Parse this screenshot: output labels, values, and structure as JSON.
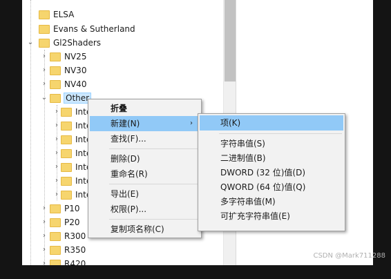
{
  "tree": {
    "items": [
      {
        "label": "ELSA"
      },
      {
        "label": "Evans & Sutherland"
      },
      {
        "label": "Gl2Shaders"
      },
      {
        "label": "NV25"
      },
      {
        "label": "NV30"
      },
      {
        "label": "NV40"
      },
      {
        "label": "Other"
      },
      {
        "label": "Inte"
      },
      {
        "label": "Inte"
      },
      {
        "label": "Inte"
      },
      {
        "label": "Inte"
      },
      {
        "label": "Inte"
      },
      {
        "label": "Inte"
      },
      {
        "label": "Inte"
      },
      {
        "label": "P10"
      },
      {
        "label": "P20"
      },
      {
        "label": "R300"
      },
      {
        "label": "R350"
      },
      {
        "label": "R420"
      }
    ],
    "expand_glyph": "⌄",
    "collapse_glyph": "›"
  },
  "context_menu": {
    "items": [
      "折叠",
      "新建(N)",
      "查找(F)...",
      "删除(D)",
      "重命名(R)",
      "导出(E)",
      "权限(P)...",
      "复制项名称(C)"
    ],
    "submenu_arrow": "›"
  },
  "submenu": {
    "items": [
      "项(K)",
      "字符串值(S)",
      "二进制值(B)",
      "DWORD (32 位)值(D)",
      "QWORD (64 位)值(Q)",
      "多字符串值(M)",
      "可扩充字符串值(E)"
    ]
  },
  "watermark": "CSDN @Mark711288"
}
